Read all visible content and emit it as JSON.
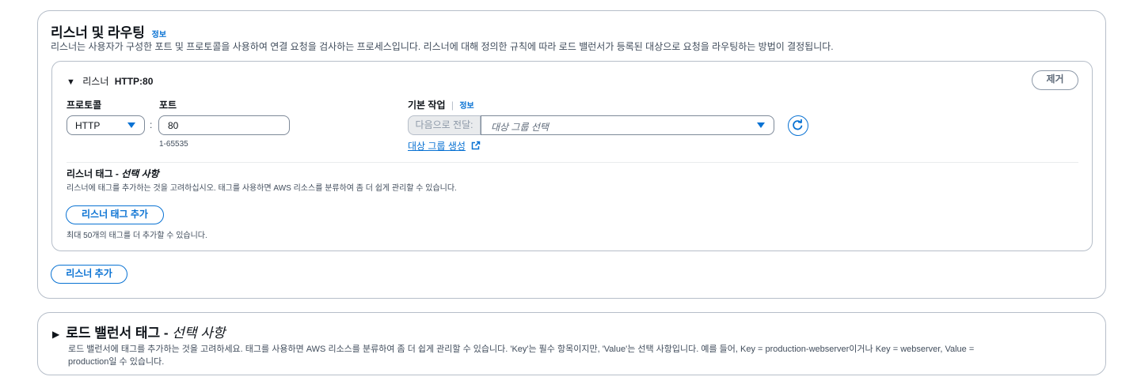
{
  "listeners_section": {
    "title": "리스너 및 라우팅",
    "info": "정보",
    "description": "리스너는 사용자가 구성한 포트 및 프로토콜을 사용하여 연결 요청을 검사하는 프로세스입니다. 리스너에 대해 정의한 규칙에 따라 로드 밸런서가 등록된 대상으로 요청을 라우팅하는 방법이 결정됩니다.",
    "listener": {
      "header_prefix": "리스너",
      "header_name": "HTTP:80",
      "remove_label": "제거",
      "protocol_label": "프로토콜",
      "protocol_value": "HTTP",
      "port_label": "포트",
      "port_value": "80",
      "port_hint": "1-65535",
      "separator": ":",
      "default_action_label": "기본 작업",
      "default_action_info": "정보",
      "forward_prefix": "다음으로 전달:",
      "target_group_placeholder": "대상 그룹 선택",
      "create_target_group": "대상 그룹 생성",
      "tags_title": "리스너 태그 - ",
      "tags_title_optional": "선택 사항",
      "tags_description": "리스너에 태그를 추가하는 것을 고려하십시오. 태그를 사용하면 AWS 리소스를 분류하여 좀 더 쉽게 관리할 수 있습니다.",
      "add_tag_button": "리스너 태그 추가",
      "tags_limit": "최대 50개의 태그를 더 추가할 수 있습니다."
    },
    "add_listener_button": "리스너 추가"
  },
  "lb_tags_section": {
    "title": "로드 밸런서 태그 - ",
    "title_optional": "선택 사항",
    "description_line1": "로드 밸런서에 태그를 추가하는 것을 고려하세요. 태그를 사용하면 AWS 리소스를 분류하여 좀 더 쉽게 관리할 수 있습니다. 'Key'는 필수 항목이지만, 'Value'는 선택 사항입니다. 예를 들어, Key = production-webserver이거나 Key = webserver, Value =",
    "description_line2": "production일 수 있습니다."
  },
  "colors": {
    "accent": "#0972d3",
    "border": "#b6bec9",
    "text": "#0f141a"
  },
  "icons": [
    "caret-down-icon",
    "refresh-icon",
    "external-link-icon",
    "expand-triangle-icon",
    "collapse-triangle-icon"
  ]
}
